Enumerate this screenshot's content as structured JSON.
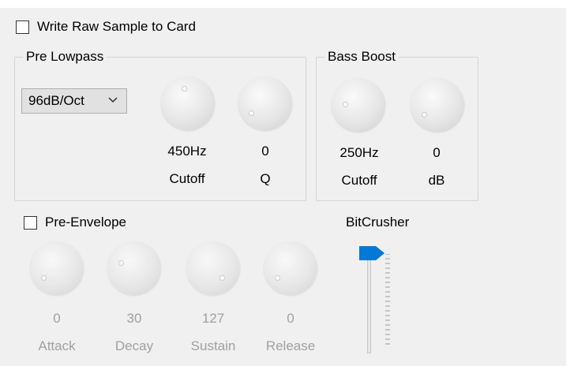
{
  "write_raw": {
    "label": "Write Raw Sample to Card",
    "checked": false
  },
  "pre_lowpass": {
    "title": "Pre Lowpass",
    "slope": "96dB/Oct",
    "knobs": [
      {
        "value": "450Hz",
        "label": "Cutoff"
      },
      {
        "value": "0",
        "label": "Q"
      }
    ]
  },
  "bass_boost": {
    "title": "Bass Boost",
    "knobs": [
      {
        "value": "250Hz",
        "label": "Cutoff"
      },
      {
        "value": "0",
        "label": "dB"
      }
    ]
  },
  "pre_envelope": {
    "label": "Pre-Envelope",
    "checked": false,
    "knobs": [
      {
        "value": "0",
        "label": "Attack"
      },
      {
        "value": "30",
        "label": "Decay"
      },
      {
        "value": "127",
        "label": "Sustain"
      },
      {
        "value": "0",
        "label": "Release"
      }
    ]
  },
  "bitcrusher": {
    "label": "BitCrusher",
    "level": 1.0
  },
  "colors": {
    "accent": "#0078d7",
    "disabled_text": "#a0a0a0"
  },
  "icons": {
    "dropdown": "chevron-down-icon"
  }
}
